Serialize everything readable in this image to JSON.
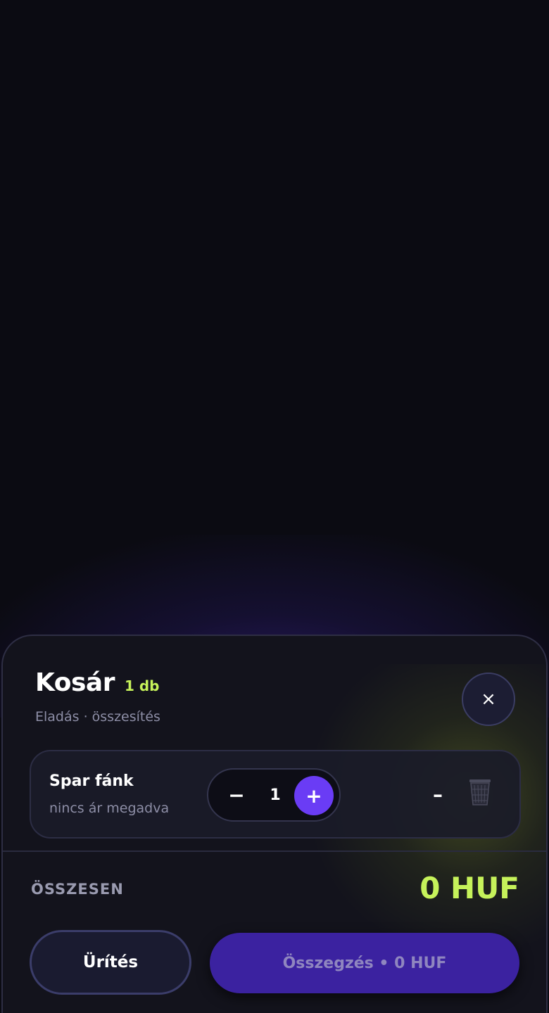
{
  "cart": {
    "title": "Kosár",
    "count": "1 db",
    "subtitle": "Eladás · összesítés",
    "close_icon": "×",
    "items": [
      {
        "name": "Spar fánk",
        "price_note": "nincs ár megadva",
        "minus": "−",
        "quantity": "1",
        "plus": "+",
        "line_total": "–"
      }
    ],
    "total_label": "ÖSSZESEN",
    "total_value": "0 HUF",
    "clear_label": "Ürítés",
    "checkout_label": "Összegzés • 0 HUF"
  },
  "colors": {
    "background": "#0b0b12",
    "sheet": "#13131c",
    "accent_lime": "#c6f25a",
    "accent_purple": "#6a3cf5",
    "checkout_bg": "#3b22a0"
  }
}
